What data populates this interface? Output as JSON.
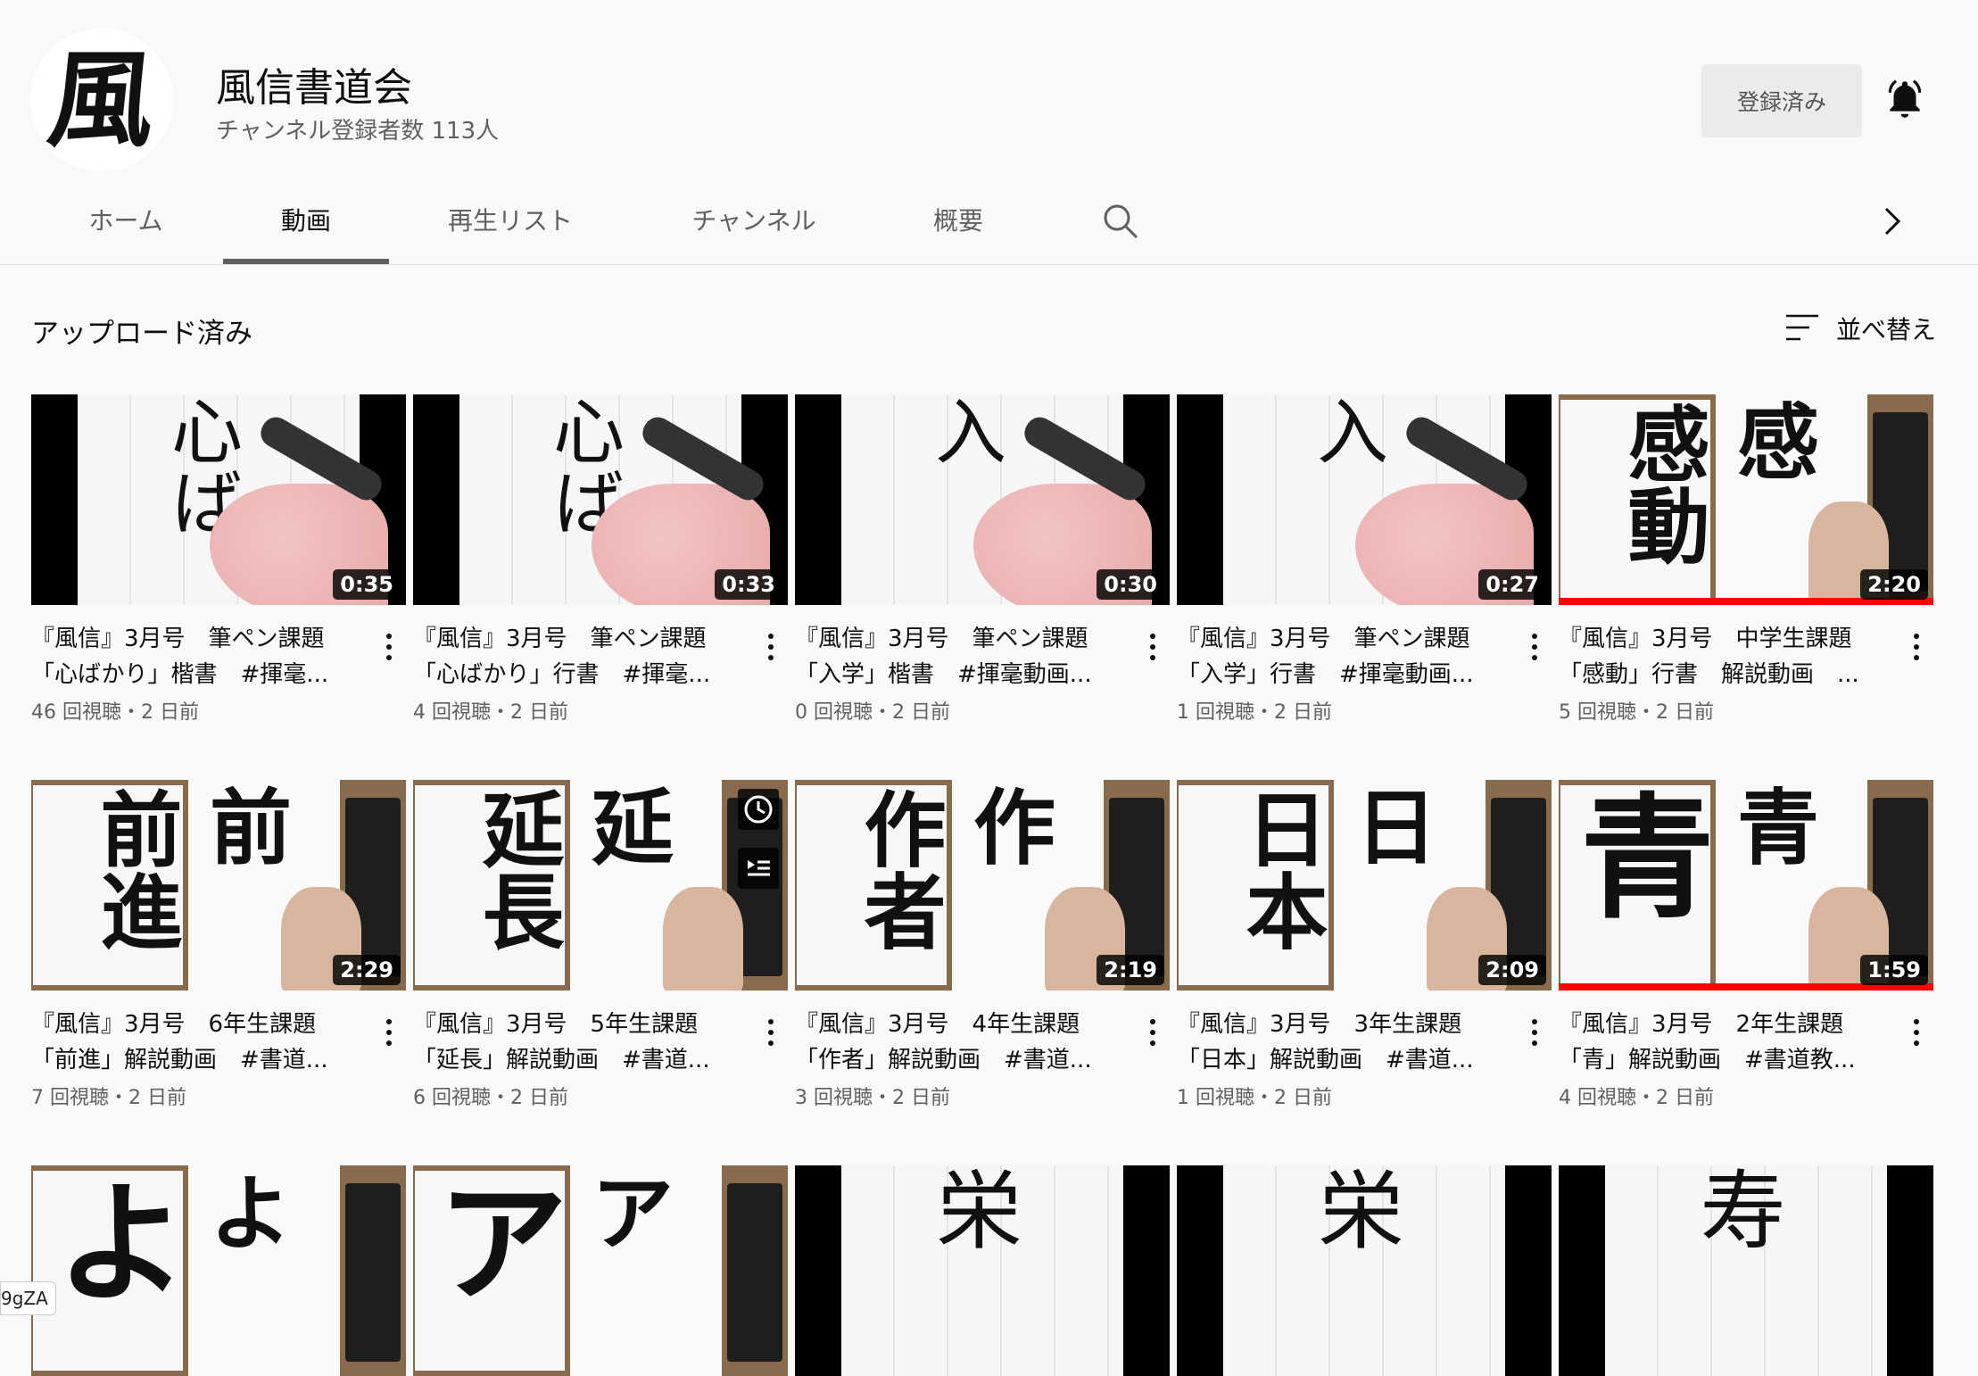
{
  "channel": {
    "avatar_char": "風",
    "name": "風信書道会",
    "subscribers": "チャンネル登録者数 113人",
    "subscribe_label": "登録済み"
  },
  "tabs": [
    {
      "label": "ホーム",
      "active": false
    },
    {
      "label": "動画",
      "active": true
    },
    {
      "label": "再生リスト",
      "active": false
    },
    {
      "label": "チャンネル",
      "active": false
    },
    {
      "label": "概要",
      "active": false
    }
  ],
  "section": {
    "title": "アップロード済み",
    "sort_label": "並べ替え"
  },
  "videos": [
    {
      "line1": "『風信』3月号　筆ペン課題",
      "line2": "「心ばかり」楷書　#揮毫...",
      "meta": "46 回視聴・2 日前",
      "duration": "0:35",
      "thumb_chars": "心ば",
      "style": "pen"
    },
    {
      "line1": "『風信』3月号　筆ペン課題",
      "line2": "「心ばかり」行書　#揮毫...",
      "meta": "4 回視聴・2 日前",
      "duration": "0:33",
      "thumb_chars": "心ば",
      "style": "pen"
    },
    {
      "line1": "『風信』3月号　筆ペン課題",
      "line2": "「入学」楷書　#揮毫動画...",
      "meta": "0 回視聴・2 日前",
      "duration": "0:30",
      "thumb_chars": "入",
      "style": "pen"
    },
    {
      "line1": "『風信』3月号　筆ペン課題",
      "line2": "「入学」行書　#揮毫動画...",
      "meta": "1 回視聴・2 日前",
      "duration": "0:27",
      "thumb_chars": "入",
      "style": "pen"
    },
    {
      "line1": "『風信』3月号　中学生課題",
      "line2": "「感動」行書　解説動画　...",
      "meta": "5 回視聴・2 日前",
      "duration": "2:20",
      "thumb_chars": "感動",
      "style": "brush",
      "progress": 1.0
    },
    {
      "line1": "『風信』3月号　6年生課題",
      "line2": "「前進」解説動画　#書道...",
      "meta": "7 回視聴・2 日前",
      "duration": "2:29",
      "thumb_chars": "前進",
      "style": "brush"
    },
    {
      "line1": "『風信』3月号　5年生課題",
      "line2": "「延長」解説動画　#書道...",
      "meta": "6 回視聴・2 日前",
      "duration": "",
      "thumb_chars": "延長",
      "style": "brush",
      "hover": true
    },
    {
      "line1": "『風信』3月号　4年生課題",
      "line2": "「作者」解説動画　#書道...",
      "meta": "3 回視聴・2 日前",
      "duration": "2:19",
      "thumb_chars": "作者",
      "style": "brush"
    },
    {
      "line1": "『風信』3月号　3年生課題",
      "line2": "「日本」解説動画　#書道...",
      "meta": "1 回視聴・2 日前",
      "duration": "2:09",
      "thumb_chars": "日本",
      "style": "brush"
    },
    {
      "line1": "『風信』3月号　2年生課題",
      "line2": "「青」解説動画　#書道教...",
      "meta": "4 回視聴・2 日前",
      "duration": "1:59",
      "thumb_chars": "青",
      "style": "brush",
      "progress": 1.0
    },
    {
      "thumb_chars": "よ",
      "style": "brush-partial"
    },
    {
      "thumb_chars": "ア",
      "style": "brush-partial"
    },
    {
      "thumb_chars": "栄",
      "style": "pen-partial"
    },
    {
      "thumb_chars": "栄",
      "style": "pen-partial"
    },
    {
      "thumb_chars": "寿",
      "style": "pen-partial"
    }
  ],
  "corner_tag": "9gZA",
  "icons": {
    "bell": "bell-icon",
    "search": "search-icon",
    "sort": "sort-icon",
    "chevron": "chevron-right-icon",
    "menu": "more-vert-icon",
    "watch_later": "clock-icon",
    "queue": "add-to-queue-icon"
  },
  "colors": {
    "progress": "#ff0000",
    "background": "#f9f9f9"
  }
}
